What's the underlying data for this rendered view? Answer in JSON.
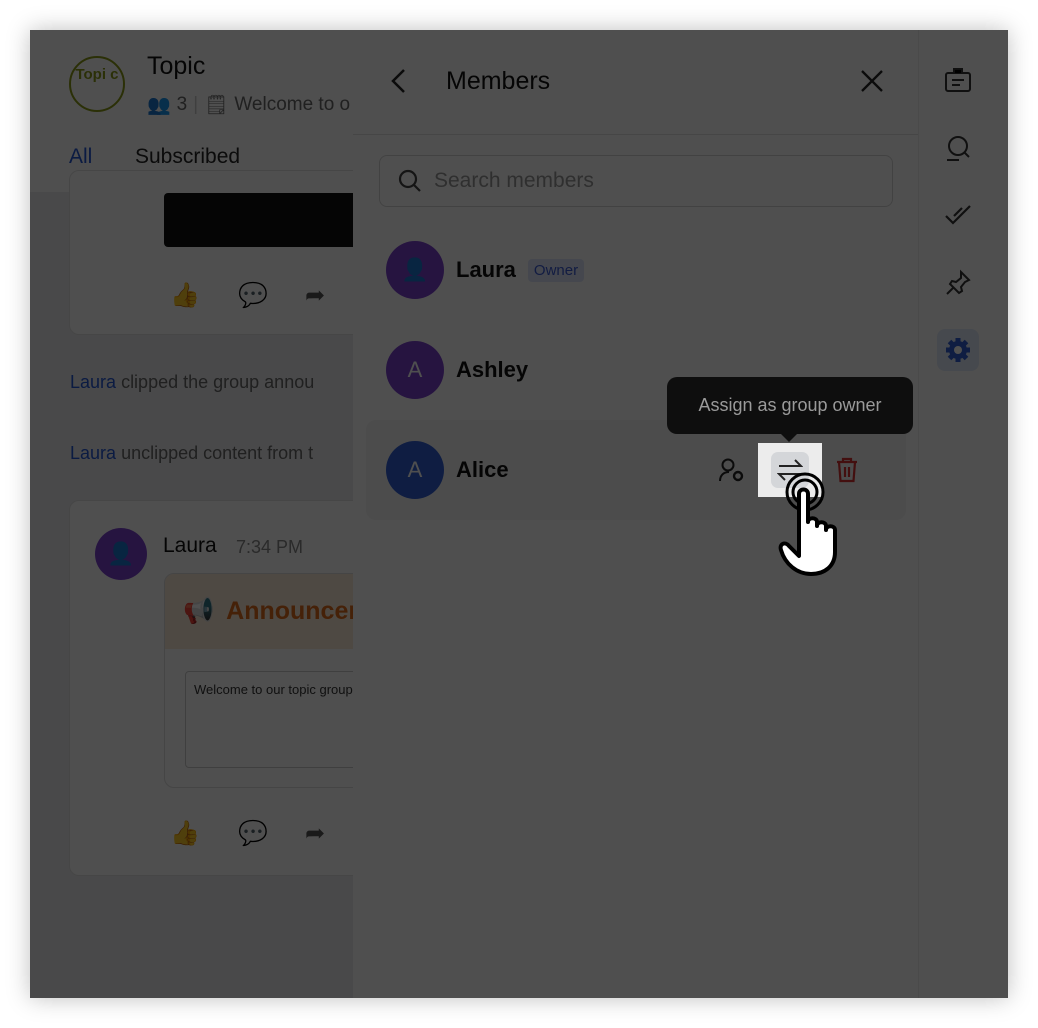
{
  "group": {
    "avatar_text": "Topi c",
    "title": "Topic",
    "member_count": "3",
    "description": "Welcome to o"
  },
  "tabs": [
    {
      "label": "All",
      "active": true
    },
    {
      "label": "Subscribed",
      "active": false
    }
  ],
  "feed": {
    "system_messages": [
      {
        "name": "Laura",
        "text": "clipped the group annou"
      },
      {
        "name": "Laura",
        "text": "unclipped content from t"
      }
    ],
    "post": {
      "author": "Laura",
      "time": "7:34 PM",
      "announcement_title": "Announcemen",
      "announcement_body": "Welcome to our topic group"
    }
  },
  "members_panel": {
    "title": "Members",
    "search_placeholder": "Search members",
    "members": [
      {
        "name": "Laura",
        "badge": "Owner",
        "avatar": "person-icon",
        "color": "#7b3fd0"
      },
      {
        "name": "Ashley",
        "avatar_letter": "A",
        "color": "#7b3fd0"
      },
      {
        "name": "Alice",
        "avatar_letter": "A",
        "color": "#2f5fd6"
      }
    ],
    "tooltip": "Assign as group owner"
  },
  "toolbar": [
    "announcement-icon",
    "search-icon",
    "tasks-icon",
    "pin-icon",
    "settings-icon"
  ],
  "colors": {
    "accent": "#2456d6",
    "danger": "#d93030",
    "announcement": "#e06a1a"
  }
}
